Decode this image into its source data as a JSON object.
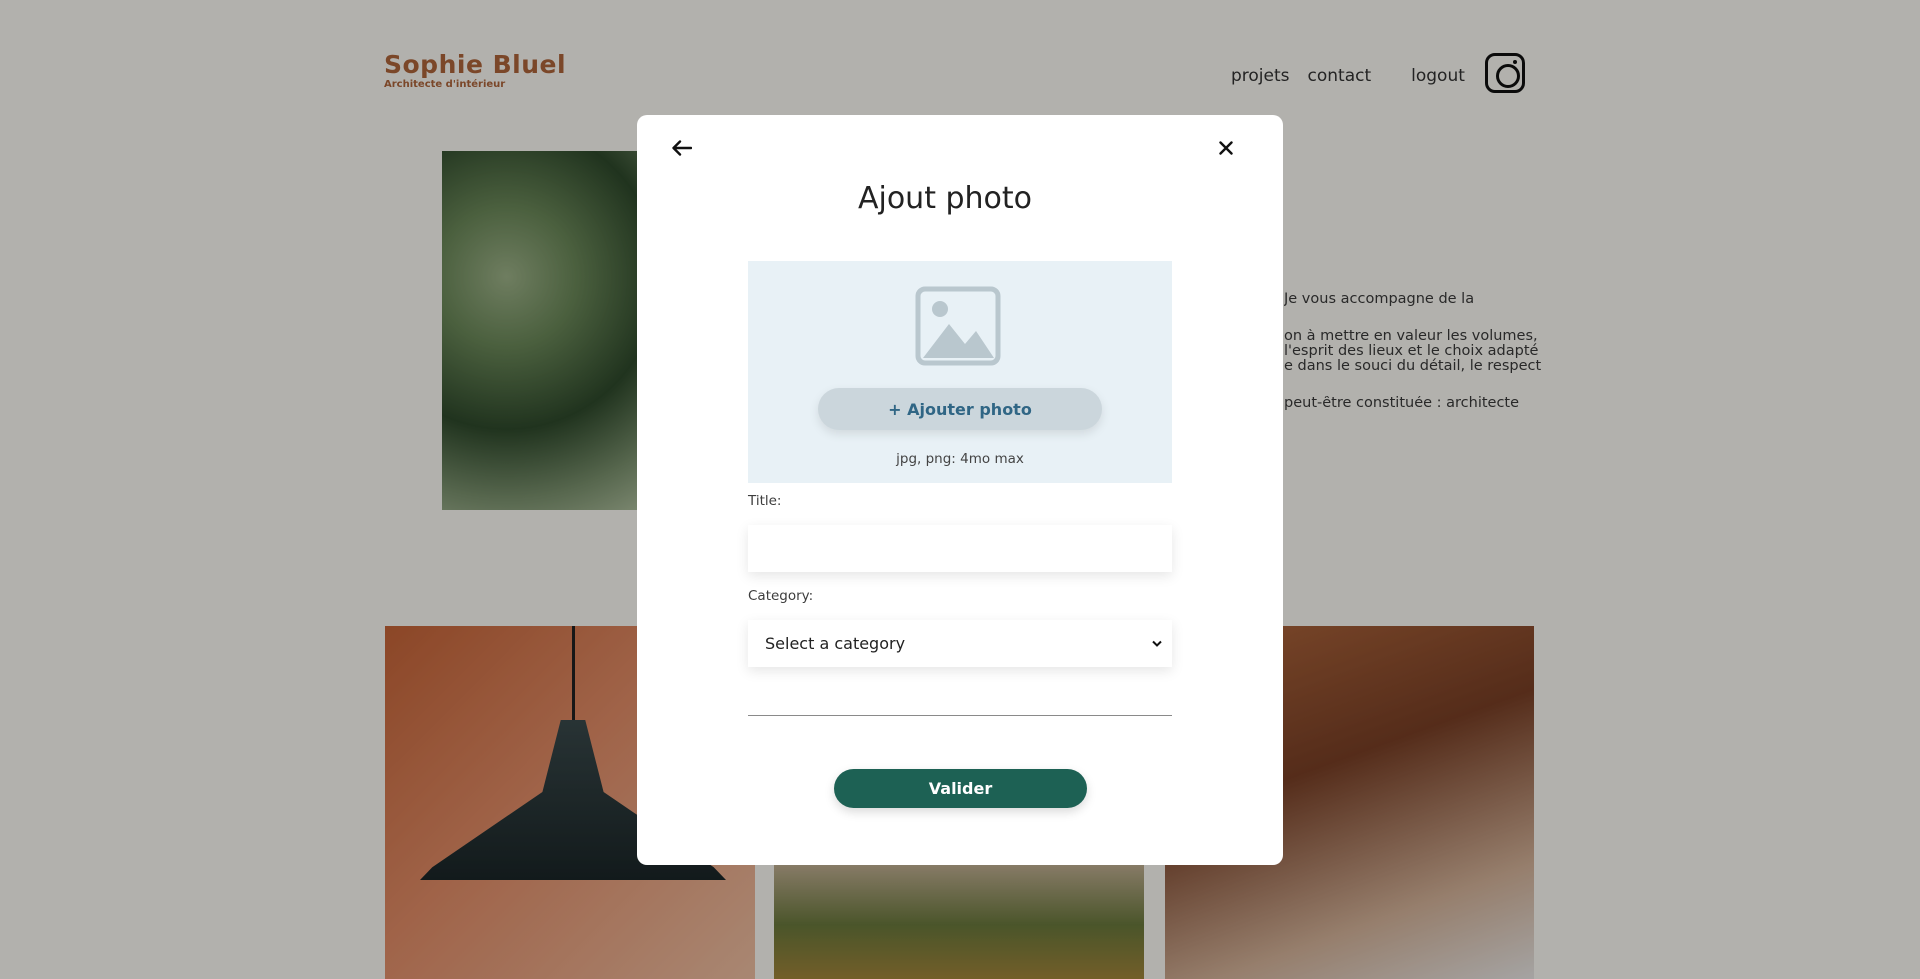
{
  "header": {
    "logo_title": "Sophie Bluel",
    "logo_subtitle": "Architecte d'intérieur",
    "nav": [
      "projets",
      "contact",
      "logout"
    ]
  },
  "intro": {
    "paragraphs": [
      "Je vous accompagne de la",
      "on à mettre en valeur les volumes,\nl'esprit des lieux et le choix adapté\ne dans le souci du détail, le respect",
      "peut-être constituée : architecte"
    ]
  },
  "modal": {
    "title": "Ajout photo",
    "upload": {
      "button_label": "+ Ajouter photo",
      "hint": "jpg, png: 4mo max"
    },
    "title_label": "Title:",
    "title_value": "",
    "category_label": "Category:",
    "category_selected": "Select a category",
    "submit_label": "Valider"
  },
  "colors": {
    "brand": "#b1663c",
    "primary_button": "#1d6154",
    "upload_bg": "#e8f1f6",
    "add_photo_text": "#306685"
  },
  "icons": [
    "arrow-left-icon",
    "close-icon",
    "image-placeholder-icon",
    "instagram-icon",
    "chevron-down-icon"
  ]
}
